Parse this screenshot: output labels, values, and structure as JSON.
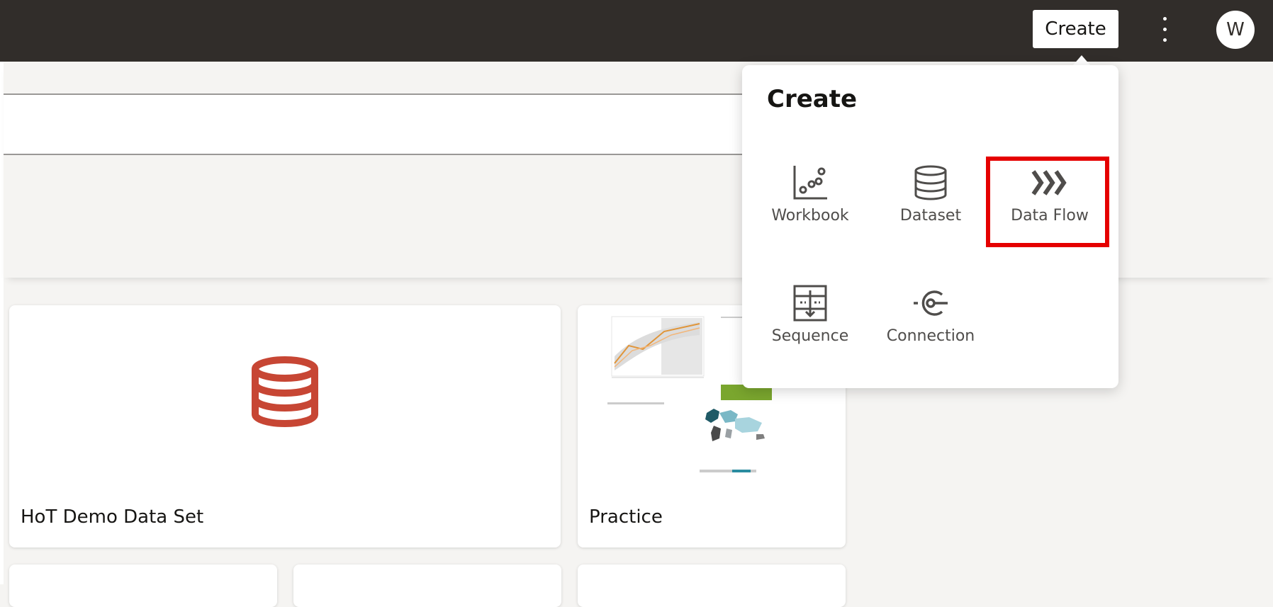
{
  "header": {
    "create_label": "Create",
    "avatar_initial": "W"
  },
  "create_menu": {
    "title": "Create",
    "items": [
      {
        "label": "Workbook",
        "icon": "workbook-icon"
      },
      {
        "label": "Dataset",
        "icon": "dataset-icon"
      },
      {
        "label": "Data Flow",
        "icon": "data-flow-icon",
        "highlighted": true
      },
      {
        "label": "Sequence",
        "icon": "sequence-icon"
      },
      {
        "label": "Connection",
        "icon": "connection-icon"
      }
    ]
  },
  "cards": [
    {
      "title": "HoT Demo Data Set",
      "icon": "database-icon"
    },
    {
      "title": "Practice",
      "thumbnail": "workbook-thumbnail"
    }
  ],
  "colors": {
    "topbar": "#312d2a",
    "accent_database": "#c74634",
    "highlight_box": "#e50000"
  }
}
